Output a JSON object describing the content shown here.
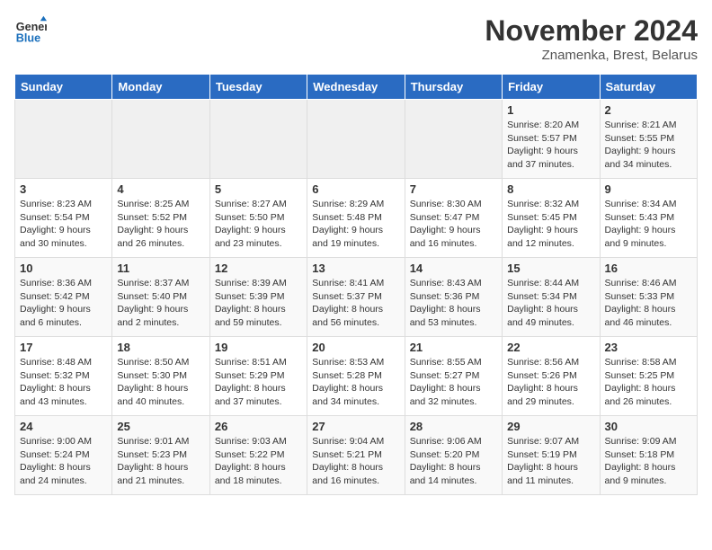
{
  "logo": {
    "line1": "General",
    "line2": "Blue"
  },
  "title": "November 2024",
  "subtitle": "Znamenka, Brest, Belarus",
  "headers": [
    "Sunday",
    "Monday",
    "Tuesday",
    "Wednesday",
    "Thursday",
    "Friday",
    "Saturday"
  ],
  "weeks": [
    [
      {
        "day": "",
        "sunrise": "",
        "sunset": "",
        "daylight": ""
      },
      {
        "day": "",
        "sunrise": "",
        "sunset": "",
        "daylight": ""
      },
      {
        "day": "",
        "sunrise": "",
        "sunset": "",
        "daylight": ""
      },
      {
        "day": "",
        "sunrise": "",
        "sunset": "",
        "daylight": ""
      },
      {
        "day": "",
        "sunrise": "",
        "sunset": "",
        "daylight": ""
      },
      {
        "day": "1",
        "sunrise": "Sunrise: 8:20 AM",
        "sunset": "Sunset: 5:57 PM",
        "daylight": "Daylight: 9 hours and 37 minutes."
      },
      {
        "day": "2",
        "sunrise": "Sunrise: 8:21 AM",
        "sunset": "Sunset: 5:55 PM",
        "daylight": "Daylight: 9 hours and 34 minutes."
      }
    ],
    [
      {
        "day": "3",
        "sunrise": "Sunrise: 8:23 AM",
        "sunset": "Sunset: 5:54 PM",
        "daylight": "Daylight: 9 hours and 30 minutes."
      },
      {
        "day": "4",
        "sunrise": "Sunrise: 8:25 AM",
        "sunset": "Sunset: 5:52 PM",
        "daylight": "Daylight: 9 hours and 26 minutes."
      },
      {
        "day": "5",
        "sunrise": "Sunrise: 8:27 AM",
        "sunset": "Sunset: 5:50 PM",
        "daylight": "Daylight: 9 hours and 23 minutes."
      },
      {
        "day": "6",
        "sunrise": "Sunrise: 8:29 AM",
        "sunset": "Sunset: 5:48 PM",
        "daylight": "Daylight: 9 hours and 19 minutes."
      },
      {
        "day": "7",
        "sunrise": "Sunrise: 8:30 AM",
        "sunset": "Sunset: 5:47 PM",
        "daylight": "Daylight: 9 hours and 16 minutes."
      },
      {
        "day": "8",
        "sunrise": "Sunrise: 8:32 AM",
        "sunset": "Sunset: 5:45 PM",
        "daylight": "Daylight: 9 hours and 12 minutes."
      },
      {
        "day": "9",
        "sunrise": "Sunrise: 8:34 AM",
        "sunset": "Sunset: 5:43 PM",
        "daylight": "Daylight: 9 hours and 9 minutes."
      }
    ],
    [
      {
        "day": "10",
        "sunrise": "Sunrise: 8:36 AM",
        "sunset": "Sunset: 5:42 PM",
        "daylight": "Daylight: 9 hours and 6 minutes."
      },
      {
        "day": "11",
        "sunrise": "Sunrise: 8:37 AM",
        "sunset": "Sunset: 5:40 PM",
        "daylight": "Daylight: 9 hours and 2 minutes."
      },
      {
        "day": "12",
        "sunrise": "Sunrise: 8:39 AM",
        "sunset": "Sunset: 5:39 PM",
        "daylight": "Daylight: 8 hours and 59 minutes."
      },
      {
        "day": "13",
        "sunrise": "Sunrise: 8:41 AM",
        "sunset": "Sunset: 5:37 PM",
        "daylight": "Daylight: 8 hours and 56 minutes."
      },
      {
        "day": "14",
        "sunrise": "Sunrise: 8:43 AM",
        "sunset": "Sunset: 5:36 PM",
        "daylight": "Daylight: 8 hours and 53 minutes."
      },
      {
        "day": "15",
        "sunrise": "Sunrise: 8:44 AM",
        "sunset": "Sunset: 5:34 PM",
        "daylight": "Daylight: 8 hours and 49 minutes."
      },
      {
        "day": "16",
        "sunrise": "Sunrise: 8:46 AM",
        "sunset": "Sunset: 5:33 PM",
        "daylight": "Daylight: 8 hours and 46 minutes."
      }
    ],
    [
      {
        "day": "17",
        "sunrise": "Sunrise: 8:48 AM",
        "sunset": "Sunset: 5:32 PM",
        "daylight": "Daylight: 8 hours and 43 minutes."
      },
      {
        "day": "18",
        "sunrise": "Sunrise: 8:50 AM",
        "sunset": "Sunset: 5:30 PM",
        "daylight": "Daylight: 8 hours and 40 minutes."
      },
      {
        "day": "19",
        "sunrise": "Sunrise: 8:51 AM",
        "sunset": "Sunset: 5:29 PM",
        "daylight": "Daylight: 8 hours and 37 minutes."
      },
      {
        "day": "20",
        "sunrise": "Sunrise: 8:53 AM",
        "sunset": "Sunset: 5:28 PM",
        "daylight": "Daylight: 8 hours and 34 minutes."
      },
      {
        "day": "21",
        "sunrise": "Sunrise: 8:55 AM",
        "sunset": "Sunset: 5:27 PM",
        "daylight": "Daylight: 8 hours and 32 minutes."
      },
      {
        "day": "22",
        "sunrise": "Sunrise: 8:56 AM",
        "sunset": "Sunset: 5:26 PM",
        "daylight": "Daylight: 8 hours and 29 minutes."
      },
      {
        "day": "23",
        "sunrise": "Sunrise: 8:58 AM",
        "sunset": "Sunset: 5:25 PM",
        "daylight": "Daylight: 8 hours and 26 minutes."
      }
    ],
    [
      {
        "day": "24",
        "sunrise": "Sunrise: 9:00 AM",
        "sunset": "Sunset: 5:24 PM",
        "daylight": "Daylight: 8 hours and 24 minutes."
      },
      {
        "day": "25",
        "sunrise": "Sunrise: 9:01 AM",
        "sunset": "Sunset: 5:23 PM",
        "daylight": "Daylight: 8 hours and 21 minutes."
      },
      {
        "day": "26",
        "sunrise": "Sunrise: 9:03 AM",
        "sunset": "Sunset: 5:22 PM",
        "daylight": "Daylight: 8 hours and 18 minutes."
      },
      {
        "day": "27",
        "sunrise": "Sunrise: 9:04 AM",
        "sunset": "Sunset: 5:21 PM",
        "daylight": "Daylight: 8 hours and 16 minutes."
      },
      {
        "day": "28",
        "sunrise": "Sunrise: 9:06 AM",
        "sunset": "Sunset: 5:20 PM",
        "daylight": "Daylight: 8 hours and 14 minutes."
      },
      {
        "day": "29",
        "sunrise": "Sunrise: 9:07 AM",
        "sunset": "Sunset: 5:19 PM",
        "daylight": "Daylight: 8 hours and 11 minutes."
      },
      {
        "day": "30",
        "sunrise": "Sunrise: 9:09 AM",
        "sunset": "Sunset: 5:18 PM",
        "daylight": "Daylight: 8 hours and 9 minutes."
      }
    ]
  ]
}
